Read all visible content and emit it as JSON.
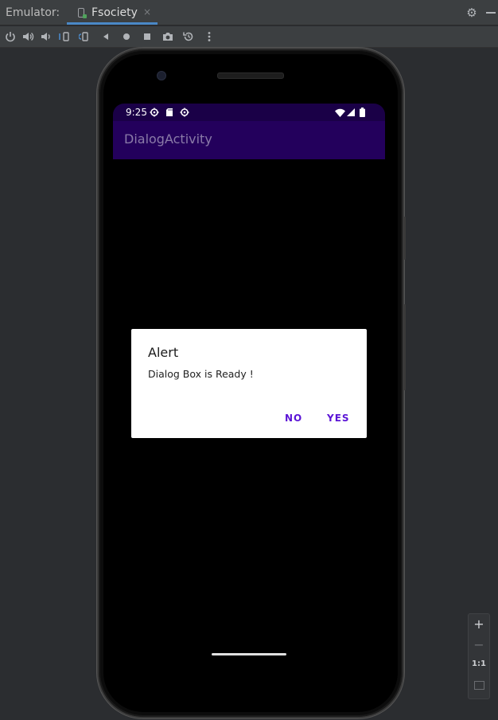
{
  "window": {
    "title": "Emulator:",
    "tab_label": "Fsociety",
    "tab_close": "×"
  },
  "toolbar": {
    "icons": [
      "power-icon",
      "volume-up-icon",
      "volume-down-icon",
      "rotate-left-icon",
      "rotate-right-icon",
      "back-icon",
      "home-icon",
      "overview-icon",
      "camera-icon",
      "snapshot-icon",
      "more-icon"
    ]
  },
  "device": {
    "status_time": "9:25",
    "app_title": "DialogActivity",
    "dialog": {
      "title": "Alert",
      "message": "Dialog Box is Ready !",
      "negative": "NO",
      "positive": "YES"
    }
  },
  "zoom": {
    "plus": "+",
    "minus": "−",
    "actual": "1:1"
  },
  "colors": {
    "status_bar": "#1a0047",
    "app_bar": "#23005c",
    "dialog_button": "#5b14d6"
  }
}
